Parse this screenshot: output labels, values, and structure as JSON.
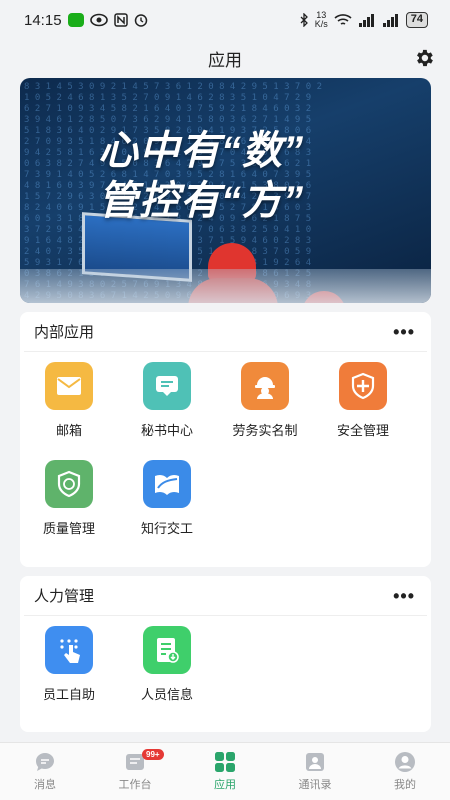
{
  "status_bar": {
    "time": "14:15",
    "speed_value": "13",
    "speed_unit": "K/s",
    "battery": "74"
  },
  "header": {
    "title": "应用"
  },
  "banner": {
    "line1": "心中有“数”",
    "line2": "管控有“方”"
  },
  "internal_apps": {
    "title": "内部应用",
    "more": "•••",
    "items": [
      {
        "label": "邮箱",
        "icon": "mail-icon",
        "color": "#f5b942"
      },
      {
        "label": "秘书中心",
        "icon": "message-icon",
        "color": "#4fc1b6"
      },
      {
        "label": "劳务实名制",
        "icon": "worker-helmet-icon",
        "color": "#f08a3b"
      },
      {
        "label": "安全管理",
        "icon": "shield-cross-icon",
        "color": "#f07c3a"
      },
      {
        "label": "质量管理",
        "icon": "quality-shield-icon",
        "color": "#5fb36b"
      },
      {
        "label": "知行交工",
        "icon": "book-icon",
        "color": "#3b8be8"
      }
    ]
  },
  "hr_apps": {
    "title": "人力管理",
    "more": "•••",
    "items": [
      {
        "label": "员工自助",
        "icon": "touch-icon",
        "color": "#3f8ef0"
      },
      {
        "label": "人员信息",
        "icon": "document-icon",
        "color": "#3fcf6b"
      }
    ]
  },
  "bottom_nav": {
    "items": [
      {
        "label": "消息",
        "icon": "chat-icon",
        "active": false
      },
      {
        "label": "工作台",
        "icon": "workbench-icon",
        "active": false,
        "badge": "99+"
      },
      {
        "label": "应用",
        "icon": "apps-grid-icon",
        "active": true
      },
      {
        "label": "通讯录",
        "icon": "contacts-icon",
        "active": false
      },
      {
        "label": "我的",
        "icon": "profile-icon",
        "active": false
      }
    ]
  },
  "colors": {
    "accent": "#2aa56b",
    "badge": "#e53935"
  }
}
